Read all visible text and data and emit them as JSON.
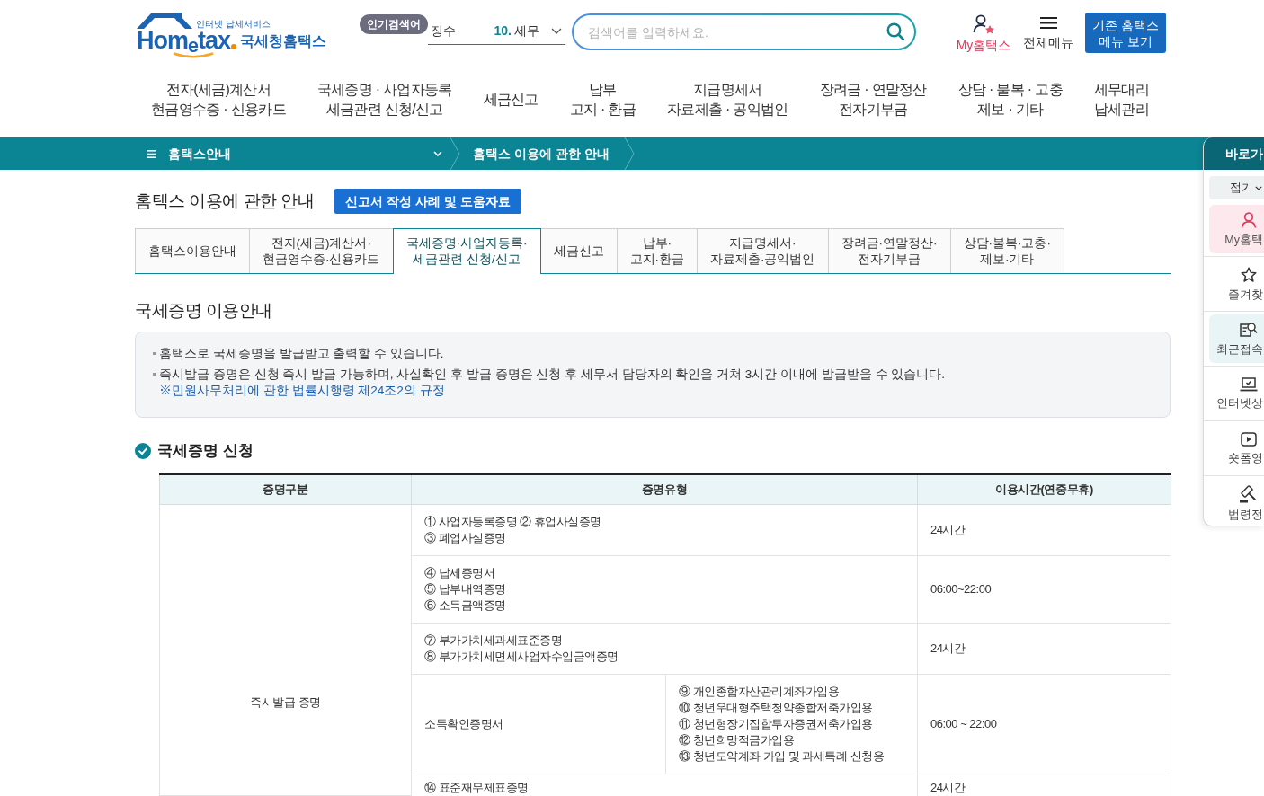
{
  "header": {
    "logo": {
      "tagline": "인터넷 납세서비스",
      "brand": "Hom$_{e}$tax",
      "site_name": "국세청홈택스"
    },
    "popular_search": {
      "label": "인기검색어",
      "previous_term": "징수",
      "rank": "10.",
      "term": "세무"
    },
    "search": {
      "placeholder": "검색어를 입력하세요."
    },
    "my_hometax": {
      "label": "My홈택스"
    },
    "all_menu": {
      "label": "전체메뉴"
    },
    "legacy_button": {
      "lines": [
        "기존 홈택스",
        "메뉴 보기"
      ]
    }
  },
  "main_nav": [
    {
      "lines": [
        "전자(세금)계산서",
        "현금영수증 · 신용카드"
      ]
    },
    {
      "lines": [
        "국세증명 · 사업자등록",
        "세금관련 신청/신고"
      ]
    },
    {
      "lines": [
        "세금신고"
      ]
    },
    {
      "lines": [
        "납부",
        "고지 · 환급"
      ]
    },
    {
      "lines": [
        "지급명세서",
        "자료제출 · 공익법인"
      ]
    },
    {
      "lines": [
        "장려금 · 연말정산",
        "전자기부금"
      ]
    },
    {
      "lines": [
        "상담 · 불복 · 고충",
        "제보 · 기타"
      ]
    },
    {
      "lines": [
        "세무대리",
        "납세관리"
      ]
    }
  ],
  "breadcrumb": {
    "menu": "홈택스안내",
    "current": "홈택스 이용에 관한 안내"
  },
  "page_title": "홈택스 이용에 관한 안내",
  "help_button": "신고서 작성 사례 및 도움자료",
  "tabs": [
    {
      "lines": [
        "홈택스이용안내"
      ],
      "selected": false
    },
    {
      "lines": [
        "전자(세금)계산서·",
        "현금영수증·신용카드"
      ],
      "selected": false
    },
    {
      "lines": [
        "국세증명·사업자등록·",
        "세금관련 신청/신고"
      ],
      "selected": true
    },
    {
      "lines": [
        "세금신고"
      ],
      "selected": false
    },
    {
      "lines": [
        "납부·",
        "고지·환급"
      ],
      "selected": false
    },
    {
      "lines": [
        "지급명세서·",
        "자료제출·공익법인"
      ],
      "selected": false
    },
    {
      "lines": [
        "장려금·연말정산·",
        "전자기부금"
      ],
      "selected": false
    },
    {
      "lines": [
        "상담·불복·고충·",
        "제보·기타"
      ],
      "selected": false
    }
  ],
  "guide": {
    "title": "국세증명 이용안내",
    "notices": [
      {
        "text": "홈택스로 국세증명을 발급받고 출력할 수 있습니다."
      },
      {
        "text": "즉시발급 증명은 신청 즉시 발급 가능하며, 사실확인 후 발급 증명은 신청 후 세무서 담당자의 확인을 거쳐 3시간 이내에 발급받을 수 있습니다.",
        "link": "※민원사무처리에 관한 법률시행령 제24조2의 규정"
      }
    ]
  },
  "application": {
    "title": "국세증명 신청",
    "table": {
      "columns": [
        "증명구분",
        "증명유형",
        "이용시간(연중무휴)"
      ],
      "groups": [
        {
          "category": "즉시발급 증명",
          "rows": [
            {
              "kind": "list",
              "items": [
                "① 사업자등록증명 ② 휴업사실증명",
                "③ 폐업사실증명"
              ],
              "hours": "24시간"
            },
            {
              "kind": "list",
              "items": [
                "④ 납세증명서",
                "⑤ 납부내역증명",
                "⑥ 소득금액증명"
              ],
              "hours": "06:00~22:00"
            },
            {
              "kind": "list",
              "items": [
                "⑦ 부가가치세과세표준증명",
                "⑧ 부가가치세면세사업자수입금액증명"
              ],
              "hours": "24시간"
            },
            {
              "kind": "split",
              "name": "소득확인증명서",
              "items": [
                "⑨ 개인종합자산관리계좌가입용",
                "⑩ 청년우대형주택청약종합저축가입용",
                "⑪ 청년형장기집합투자증권저축가입용",
                "⑫ 청년희망적금가입용",
                "⑬ 청년도약계좌 가입 및 과세특례 신청용"
              ],
              "hours": "06:00 ~ 22:00"
            },
            {
              "kind": "list",
              "items": [
                "⑭ 표준재무제표증명"
              ],
              "hours": "24시간"
            }
          ]
        }
      ]
    }
  },
  "quick_menu": {
    "title": "바로가",
    "collapse": "접기",
    "items": [
      {
        "kind": "featured",
        "label": "My홈택",
        "selected": false
      },
      {
        "kind": "link",
        "label": "즐겨찾",
        "selected": false
      },
      {
        "kind": "link",
        "label": "최근접속",
        "selected": true
      },
      {
        "kind": "link",
        "label": "인터넷상",
        "selected": false
      },
      {
        "kind": "link",
        "label": "숏폼영",
        "selected": false
      },
      {
        "kind": "link",
        "label": "법령정",
        "selected": false
      }
    ]
  }
}
